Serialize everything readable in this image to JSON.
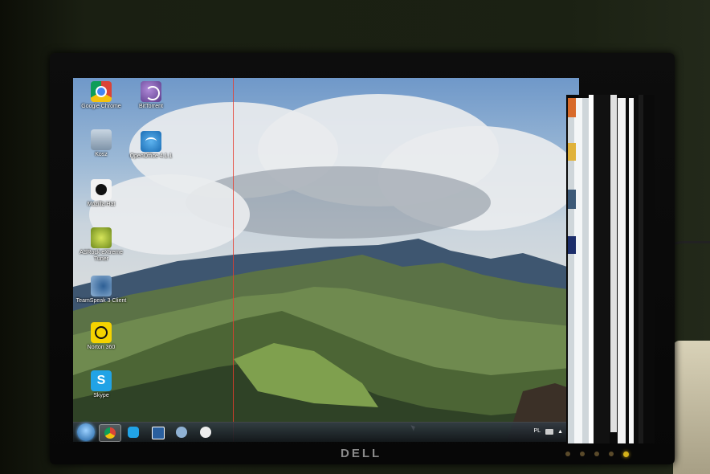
{
  "monitor": {
    "brand": "DELL"
  },
  "desktop": {
    "icons": [
      {
        "label": "Google Chrome",
        "icon": "chrome-icon"
      },
      {
        "label": "BitTorrent",
        "icon": "bittorrent-icon"
      },
      {
        "label": "Kosz",
        "icon": "recycle-bin-icon"
      },
      {
        "label": "OpenOffice 4.1.1",
        "icon": "openoffice-icon"
      },
      {
        "label": "Mozilla Hat",
        "icon": "hat-icon"
      },
      {
        "label": "ASRock eXtreme Tuner",
        "icon": "asrock-icon"
      },
      {
        "label": "TeamSpeak 3 Client",
        "icon": "teamspeak-icon"
      },
      {
        "label": "Norton 360",
        "icon": "norton-icon"
      },
      {
        "label": "Skype",
        "icon": "skype-icon"
      }
    ]
  },
  "taskbar": {
    "tray_language": "PL"
  }
}
